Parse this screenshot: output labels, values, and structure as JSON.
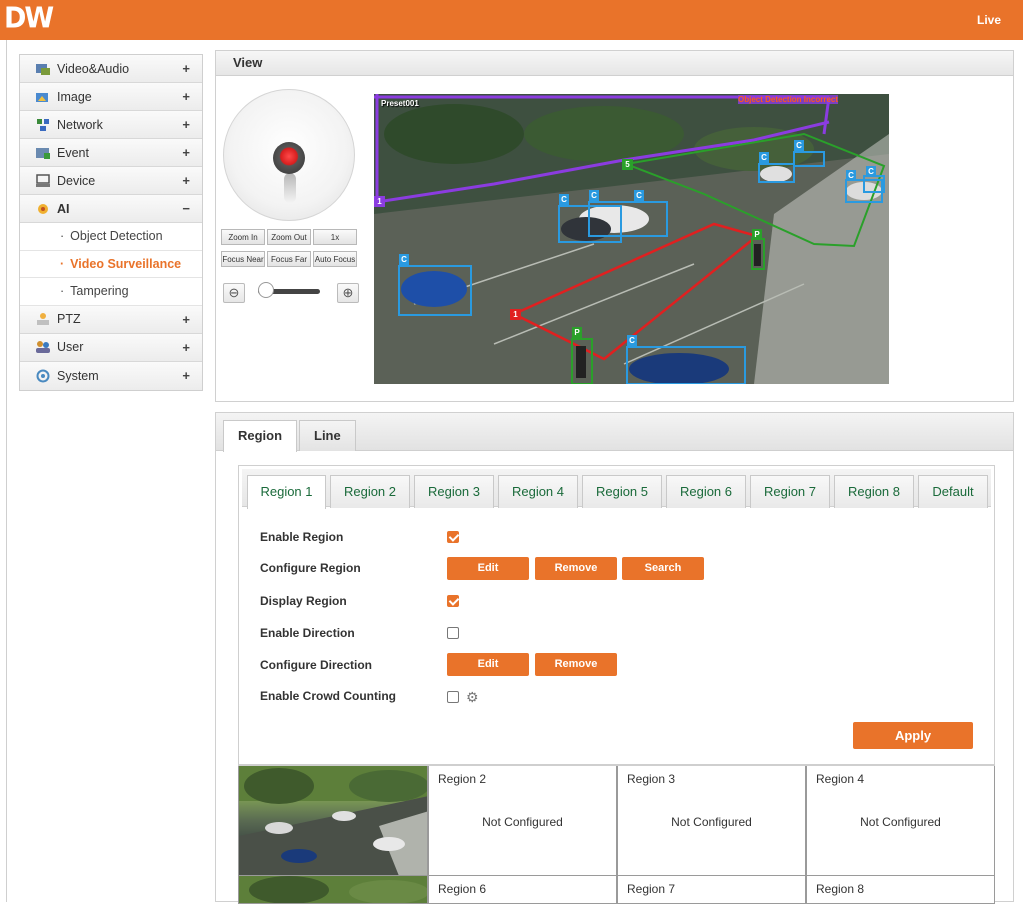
{
  "header": {
    "logo": "DW",
    "live_label": "Live"
  },
  "sidebar": {
    "items": [
      {
        "label": "Video&Audio",
        "toggle": "+"
      },
      {
        "label": "Image",
        "toggle": "+"
      },
      {
        "label": "Network",
        "toggle": "+"
      },
      {
        "label": "Event",
        "toggle": "+"
      },
      {
        "label": "Device",
        "toggle": "+"
      },
      {
        "label": "AI",
        "toggle": "−"
      },
      {
        "label": "PTZ",
        "toggle": "+"
      },
      {
        "label": "User",
        "toggle": "+"
      },
      {
        "label": "System",
        "toggle": "+"
      }
    ],
    "ai_subitems": [
      "Object Detection",
      "Video Surveillance",
      "Tampering"
    ],
    "active_subitem": "Video Surveillance"
  },
  "view": {
    "title": "View",
    "ptz_buttons": [
      "Zoom In",
      "Zoom Out",
      "1x",
      "Focus Near",
      "Focus Far",
      "Auto Focus"
    ],
    "video": {
      "preset_label": "Preset001",
      "overlay_label": "Object Detection Incorrect",
      "region_markers": [
        "1",
        "5",
        "1"
      ],
      "object_markers": [
        "C",
        "C",
        "C",
        "C",
        "C",
        "C",
        "C",
        "C",
        "P",
        "P",
        "C"
      ]
    }
  },
  "config": {
    "tabs": [
      "Region",
      "Line"
    ],
    "active_tab": "Region",
    "region_tabs": [
      "Region 1",
      "Region 2",
      "Region 3",
      "Region 4",
      "Region 5",
      "Region 6",
      "Region 7",
      "Region 8",
      "Default"
    ],
    "active_region_tab": "Region 1",
    "form": {
      "enable_region": {
        "label": "Enable Region",
        "checked": true
      },
      "configure_region": {
        "label": "Configure Region",
        "buttons": [
          "Edit",
          "Remove",
          "Search"
        ]
      },
      "display_region": {
        "label": "Display Region",
        "checked": true
      },
      "enable_direction": {
        "label": "Enable Direction",
        "checked": false
      },
      "configure_direction": {
        "label": "Configure Direction",
        "buttons": [
          "Edit",
          "Remove"
        ]
      },
      "enable_crowd_counting": {
        "label": "Enable Crowd Counting",
        "checked": false
      }
    },
    "apply_label": "Apply"
  },
  "region_grid": [
    {
      "title": "",
      "status": ""
    },
    {
      "title": "Region 2",
      "status": "Not Configured"
    },
    {
      "title": "Region 3",
      "status": "Not Configured"
    },
    {
      "title": "Region 4",
      "status": "Not Configured"
    },
    {
      "title": "",
      "status": ""
    },
    {
      "title": "Region 6",
      "status": ""
    },
    {
      "title": "Region 7",
      "status": ""
    },
    {
      "title": "Region 8",
      "status": ""
    }
  ],
  "colors": {
    "accent": "#e9732a",
    "tab_text": "#1a6a3a",
    "region_red": "#e02020",
    "region_green": "#2aa02a",
    "region_purple": "#8b3ce0",
    "object_blue": "#2a9ae0"
  }
}
